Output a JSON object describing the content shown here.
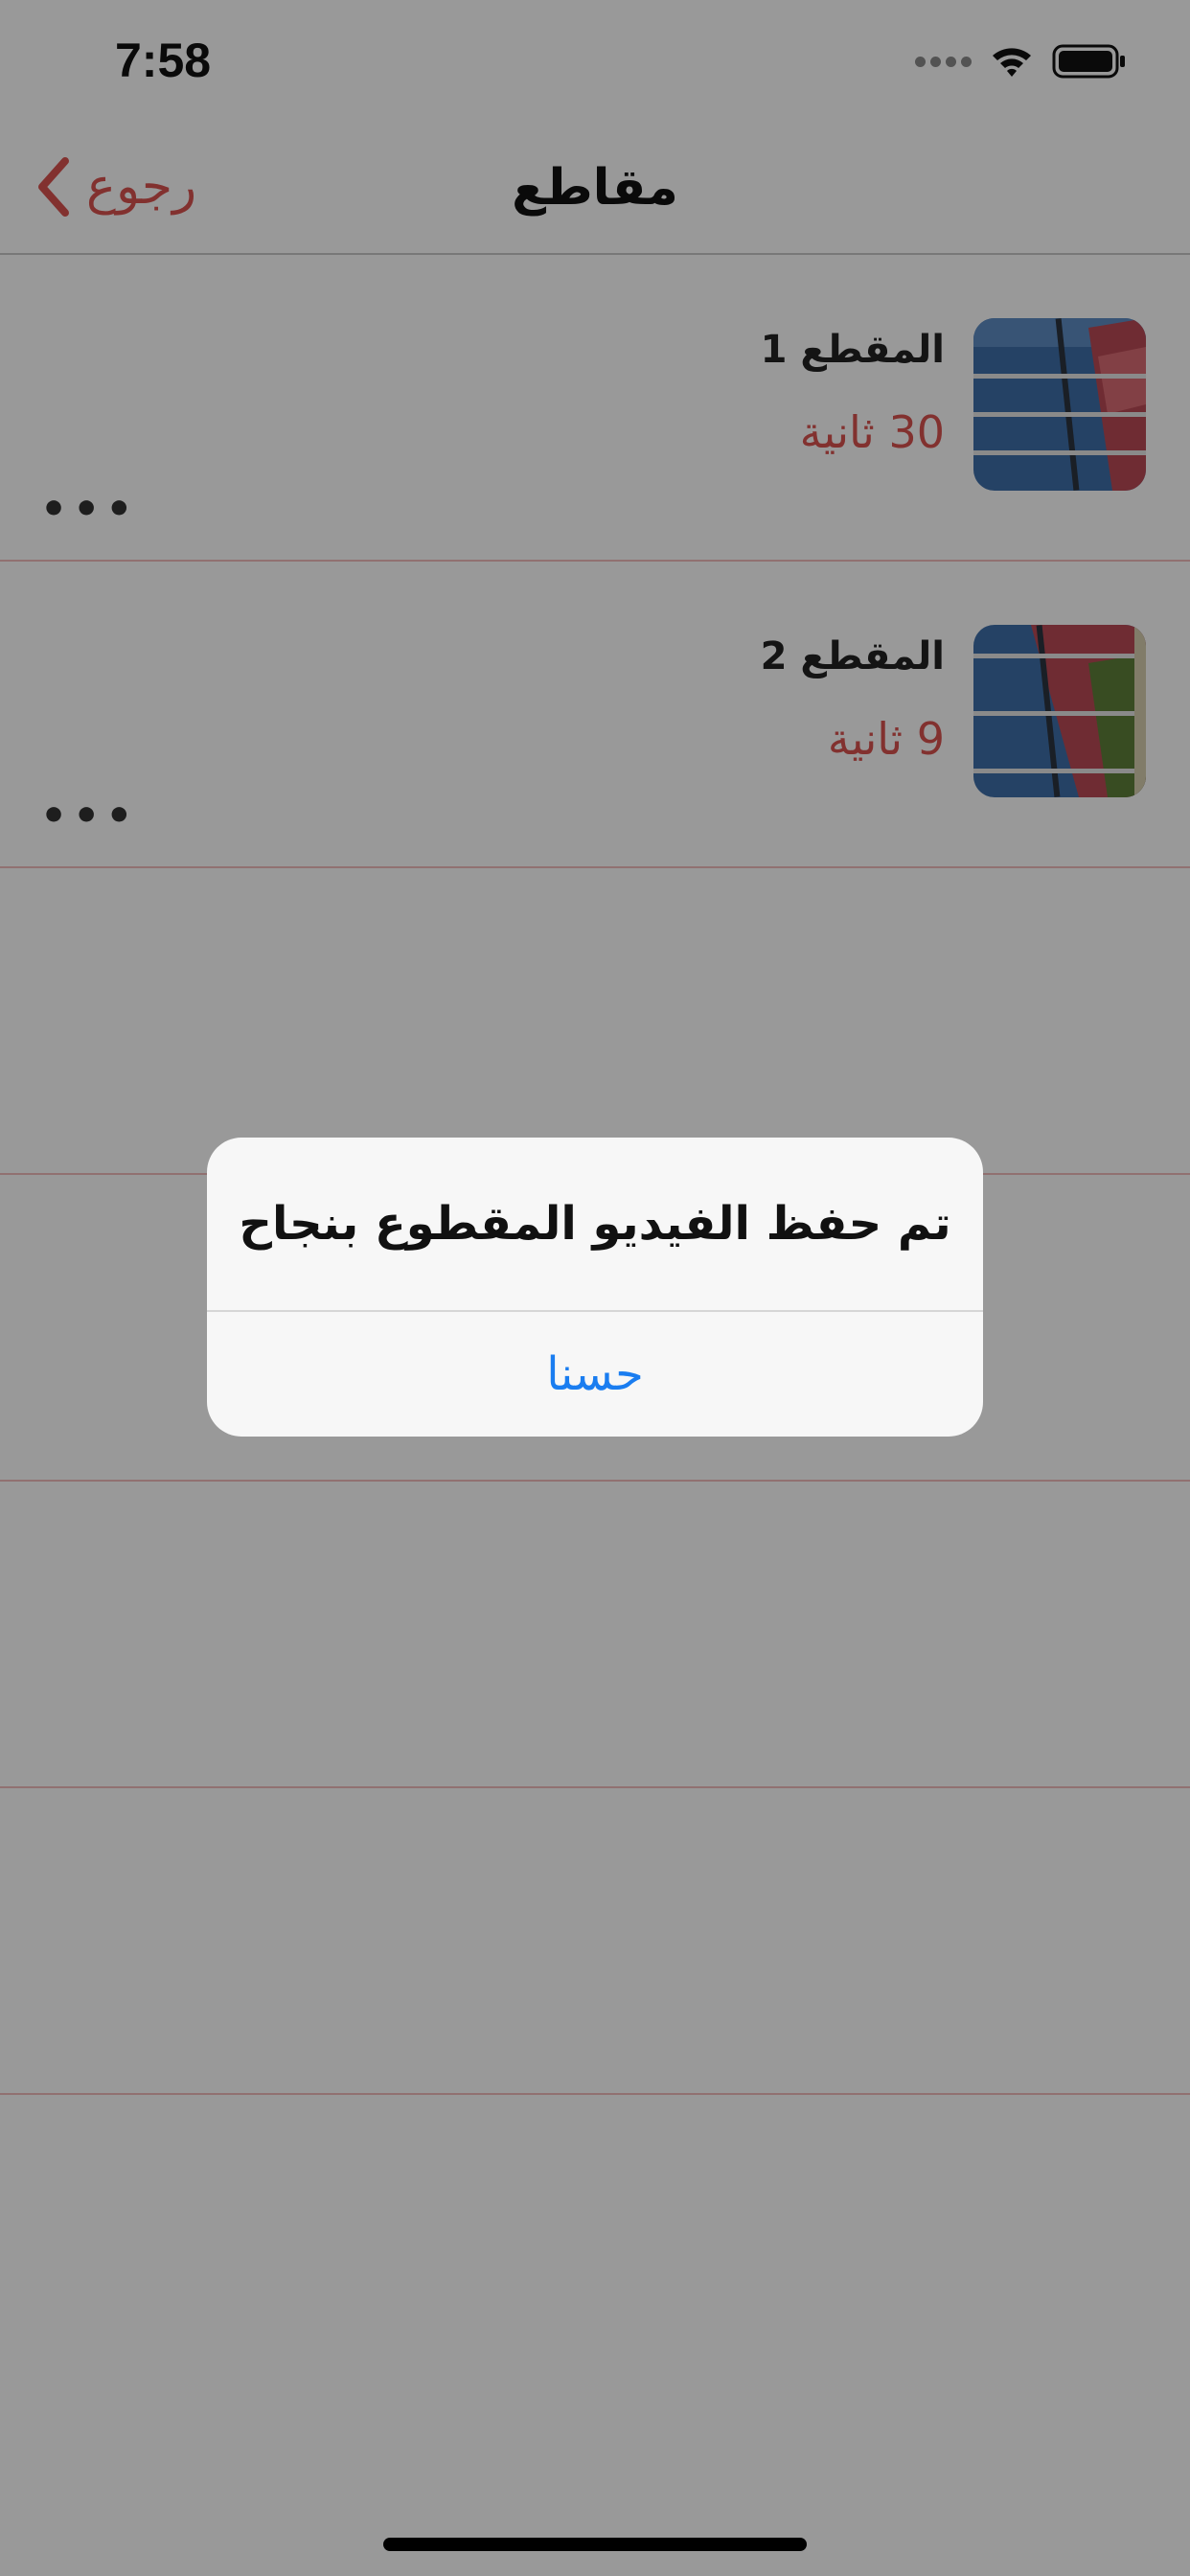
{
  "status_bar": {
    "time": "7:58"
  },
  "nav": {
    "back_label": "رجوع",
    "title": "مقاطع"
  },
  "clips": [
    {
      "title": "المقطع 1",
      "duration": "30 ثانية",
      "more": "•••"
    },
    {
      "title": "المقطع 2",
      "duration": "9 ثانية",
      "more": "•••"
    }
  ],
  "alert": {
    "message": "تم حفظ الفيديو المقطوع بنجاح",
    "button": "حسنا"
  },
  "colors": {
    "accent": "#d9534f",
    "alert_button": "#1a7df0"
  }
}
